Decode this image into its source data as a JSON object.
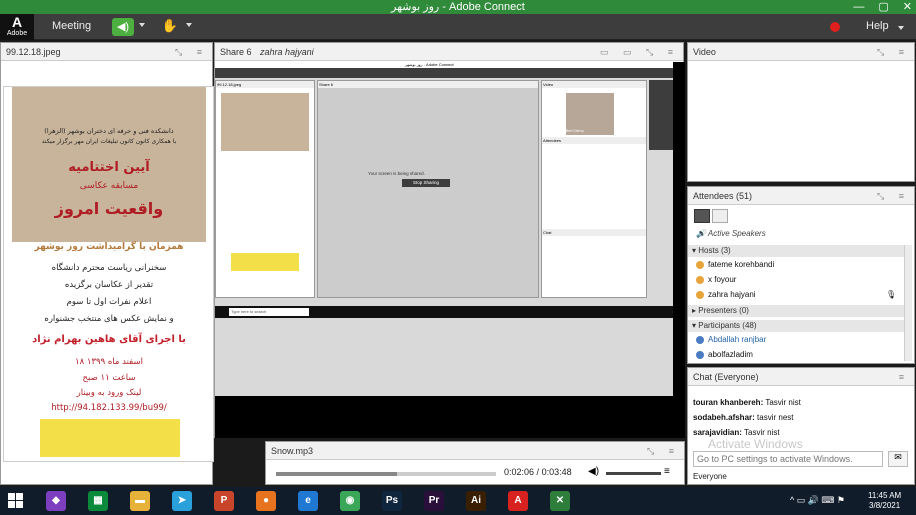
{
  "window": {
    "title": "روز بوشهر - Adobe Connect",
    "minimize": "—",
    "maximize": "▢",
    "close": "✕"
  },
  "menubar": {
    "logo_text": "Adobe",
    "meeting": "Meeting",
    "help": "Help"
  },
  "poster_pod": {
    "title": "99.12.18.jpeg",
    "lines": [
      "دانشکده فنی و حرفه ای دختران بوشهر (الزهرا)",
      "با همکاری کانون کانون تبلیغات ایران مهر برگزار میکند",
      "آیین اختتامیه",
      "مسابقه عکاسی",
      "واقعیت امروز",
      "همزمان با گرامیداشت روز بوشهر",
      "سخنرانی ریاست محترم دانشگاه",
      "تقدیر از عکاسان برگزیده",
      "اعلام نفرات اول تا سوم",
      "و نمایش عکس های منتخب جشنواره",
      "با اجرای آقای هاهین بهرام نژاد",
      "۱۸ اسفند ماه ۱۳۹۹",
      "ساعت ۱۱ صبح",
      "لینک ورود به وبینار",
      "http://94.182.133.99/bu99/"
    ]
  },
  "share_pod": {
    "title": "Share 6",
    "presenter": "zahra hajyani",
    "inner": {
      "titlebar": "روز بوشهر - Adobe Connect",
      "pod_left": "99.12.18.jpeg",
      "pod_mid": "Share 6",
      "shared_text": "Your screen is being shared.",
      "stop_sharing": "Stop Sharing",
      "pod_right": "Video",
      "video_name": "Bert Sherry",
      "attendees": "Attendees",
      "chat": "Chat",
      "taskbar_search": "Type here to search"
    }
  },
  "video_pod": {
    "title": "Video"
  },
  "attendees": {
    "title": "Attendees",
    "count": "(51)",
    "active_speakers": "Active Speakers",
    "hosts_label": "Hosts",
    "hosts_count": "(3)",
    "hosts": [
      "fateme korehbandi",
      "x foyour",
      "zahra hajyani"
    ],
    "presenters_label": "Presenters",
    "presenters_count": "(0)",
    "participants_label": "Participants",
    "participants_count": "(48)",
    "participants": [
      "Abdallah ranjbar",
      "abolfazladim"
    ]
  },
  "chat": {
    "title": "Chat",
    "scope": "(Everyone)",
    "messages": [
      {
        "user": "touran khanbereh:",
        "text": "Tasvir nist"
      },
      {
        "user": "sodabeh.afshar:",
        "text": "tasvir nest"
      },
      {
        "user": "sarajavidian:",
        "text": "Tasvir nist"
      }
    ],
    "input_placeholder": "Go to PC settings to activate Windows.",
    "audience": "Everyone"
  },
  "activate": {
    "line1": "Activate Windows"
  },
  "snow_pod": {
    "title": "Snow.mp3",
    "current": "0:02:06",
    "separator": "/",
    "total": "0:03:48",
    "progress": 0.55
  },
  "taskbar": {
    "icons": [
      {
        "name": "visual-studio-icon",
        "glyph": "◆",
        "color": "#7b3fbf"
      },
      {
        "name": "store-icon",
        "glyph": "▦",
        "color": "#0a8a3a"
      },
      {
        "name": "folder-icon",
        "glyph": "▬",
        "color": "#e6b23a"
      },
      {
        "name": "telegram-icon",
        "glyph": "➤",
        "color": "#2aa1da"
      },
      {
        "name": "powerpoint-icon",
        "glyph": "P",
        "color": "#c8442a"
      },
      {
        "name": "firefox-icon",
        "glyph": "●",
        "color": "#e8731f"
      },
      {
        "name": "edge-icon",
        "glyph": "e",
        "color": "#1f78d1"
      },
      {
        "name": "chrome-icon",
        "glyph": "◉",
        "color": "#3aa657"
      },
      {
        "name": "photoshop-icon",
        "glyph": "Ps",
        "color": "#10253e"
      },
      {
        "name": "premiere-icon",
        "glyph": "Pr",
        "color": "#2a0f3a"
      },
      {
        "name": "illustrator-icon",
        "glyph": "Ai",
        "color": "#3a1e00"
      },
      {
        "name": "acrobat-icon",
        "glyph": "A",
        "color": "#d8221f"
      },
      {
        "name": "adobe-connect-icon",
        "glyph": "✕",
        "color": "#2e7d3a"
      }
    ],
    "time": "11:45 AM",
    "date": "3/8/2021"
  }
}
